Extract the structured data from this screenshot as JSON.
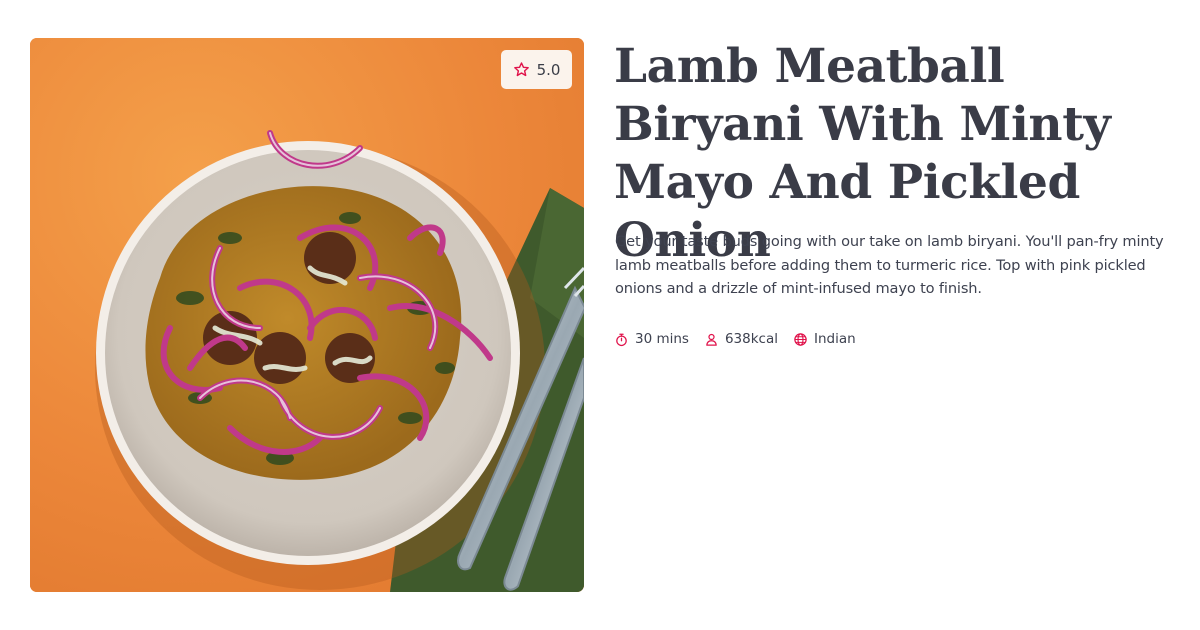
{
  "recipe": {
    "rating": "5.0",
    "title": "Lamb Meatball Biryani With Minty Mayo And Pickled Onion",
    "description": "Get your taste buds going with our take on lamb biryani. You'll pan-fry minty lamb meatballs before adding them to turmeric rice. Top with pink pickled onions and a drizzle of mint-infused mayo to finish.",
    "meta": {
      "time": "30 mins",
      "calories": "638kcal",
      "cuisine": "Indian"
    }
  },
  "icons": {
    "rating": "star-icon",
    "time": "stopwatch-icon",
    "calories": "person-icon",
    "cuisine": "globe-icon"
  },
  "colors": {
    "accent": "#e0134b",
    "background_photo": "#ec8a3c",
    "text": "#3a3c47"
  }
}
